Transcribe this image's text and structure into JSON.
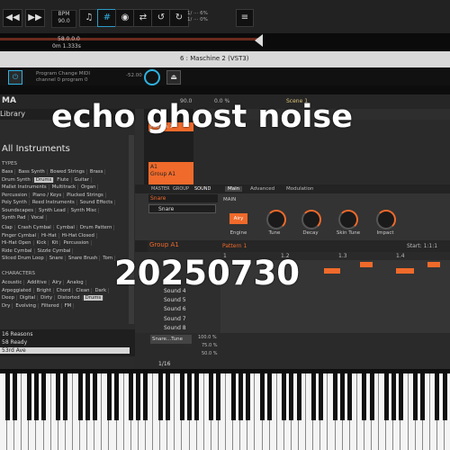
{
  "transport": {
    "bpm_label": "BPM",
    "bpm_value": "90.0",
    "cpu_l": "1/",
    "cpu_r": "6%",
    "mem_l": "1/",
    "mem_r": "0%"
  },
  "timeline": {
    "position_bars": "58.0.0.0",
    "position_time": "0m 1.333s"
  },
  "plugin": {
    "title": "6 : Maschine 2 (VST3)",
    "program_line1": "Program Change MIDI",
    "program_line2": "channel 0 program 0",
    "gain_value": "-52.00"
  },
  "maschine_header": {
    "logo": "MA",
    "tempo": "90.0",
    "swing": "0.0 %",
    "scene": "Scene 1"
  },
  "library": {
    "title": "Library",
    "all_instruments": "All Instruments",
    "types_label": "TYPES",
    "types_rows": [
      [
        "Bass",
        "Bass Synth",
        "Bowed Strings",
        "Brass"
      ],
      [
        "Drum Synth",
        "Drums",
        "Flute",
        "Guitar"
      ],
      [
        "Mallet Instruments",
        "Multitrack",
        "Organ"
      ],
      [
        "Percussion",
        "Piano / Keys",
        "Plucked Strings"
      ],
      [
        "Poly Synth",
        "Reed Instruments",
        "Sound Effects"
      ],
      [
        "Soundscapes",
        "Synth Lead",
        "Synth Misc"
      ],
      [
        "Synth Pad",
        "Vocal"
      ]
    ],
    "drum_rows": [
      [
        "Clap",
        "Crash Cymbal",
        "Cymbal",
        "Drum Pattern"
      ],
      [
        "Finger Cymbal",
        "Hi-Hat",
        "Hi-Hat Closed"
      ],
      [
        "Hi-Hat Open",
        "Kick",
        "Kit",
        "Percussion"
      ],
      [
        "Ride Cymbal",
        "Sizzle Cymbal"
      ],
      [
        "Sliced Drum Loop",
        "Snare",
        "Snare Brush",
        "Tom"
      ]
    ],
    "characters_label": "CHARACTERS",
    "char_rows": [
      [
        "Acoustic",
        "Additive",
        "Airy",
        "Analog"
      ],
      [
        "Arpeggiated",
        "Bright",
        "Chord",
        "Clean",
        "Dark"
      ],
      [
        "Deep",
        "Digital",
        "Dirty",
        "Distorted",
        "Drums"
      ],
      [
        "Dry",
        "Evolving",
        "Filtered",
        "FM"
      ]
    ],
    "list": [
      "16 Reasons",
      "58 Ready",
      "53rd Ave"
    ],
    "selected_tag": "Drums"
  },
  "pads": {
    "pattern_tab": "Pattern 1",
    "group": "A1",
    "group_name": "Group A1"
  },
  "sound": {
    "tabs": [
      "MASTER",
      "GROUP",
      "SOUND"
    ],
    "name": "Snare",
    "preset": "Snare",
    "page_tabs": [
      "Main",
      "Advanced",
      "Modulation"
    ],
    "main_label": "MAIN",
    "engine_value": "Airy",
    "knobs": [
      "Engine",
      "Tune",
      "Decay",
      "Skin Tune",
      "Impact"
    ]
  },
  "pattern": {
    "group": "Group A1",
    "pattern_name": "Pattern 1",
    "start_label": "Start: 1:1:1",
    "ruler": [
      "1",
      "1.2",
      "1.3",
      "1.4"
    ],
    "sounds": [
      "Sound 4",
      "Sound 5",
      "Sound 6",
      "Sound 7",
      "Sound 8"
    ],
    "param": "Snare...Tune",
    "values": [
      "100.0 %",
      "75.0 %",
      "50.0 %"
    ],
    "grid_label": "1/16"
  },
  "overlay": {
    "line1": "echo ghost noise",
    "line2": "20250730"
  }
}
